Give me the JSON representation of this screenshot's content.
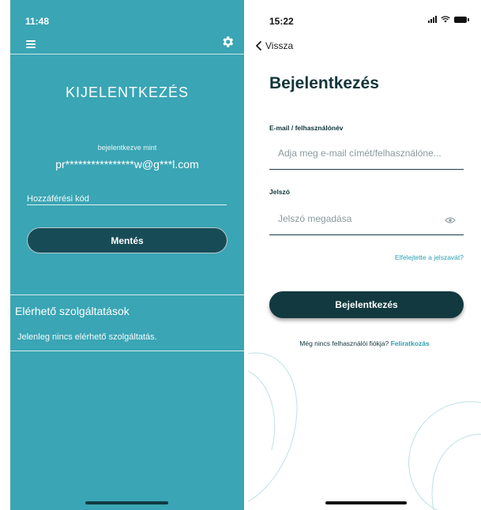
{
  "left_screen": {
    "status_time": "11:48",
    "status_dots": "....",
    "title": "KIJELENTKEZÉS",
    "logged_in_as": "bejelentkezve mint",
    "email": "pr****************w@g***l.com",
    "access_code_label": "Hozzáférési kód",
    "save_button": "Mentés",
    "services_title": "Elérhető szolgáltatások",
    "services_empty": "Jelenleg nincs elérhető szolgáltatás.",
    "colors": {
      "background": "#3aa5b4",
      "button": "#174c57"
    }
  },
  "right_screen": {
    "status_time": "15:22",
    "back_label": "Vissza",
    "heading": "Bejelentkezés",
    "email_label": "E-mail / felhasználónév",
    "email_placeholder": "Adja meg e-mail címét/felhasználóne...",
    "password_label": "Jelszó",
    "password_placeholder": "Jelszó megadása",
    "forgot_password": "Elfelejtette a jelszavát?",
    "login_button": "Bejelentkezés",
    "no_account": "Még nincs felhasználói fiókja?",
    "signup_link": "Feliratkozás",
    "colors": {
      "primary": "#12393f",
      "link": "#2e9fb3"
    }
  }
}
